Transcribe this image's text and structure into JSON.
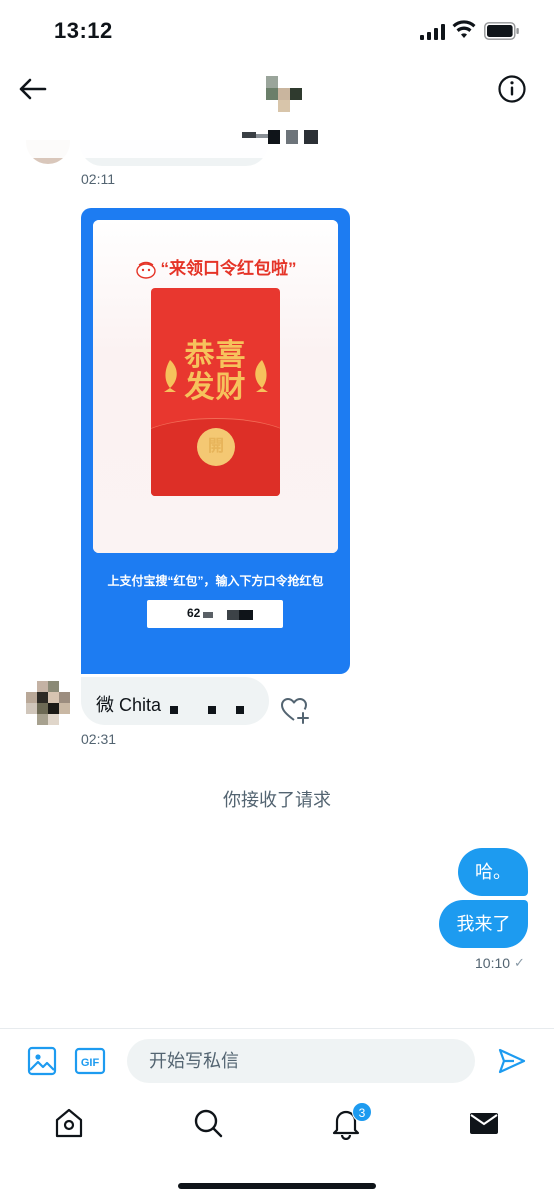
{
  "status_bar": {
    "time": "13:12"
  },
  "header": {
    "back_icon": "arrow-left-icon",
    "info_icon": "info-icon"
  },
  "conversation": {
    "first_timestamp": "02:11",
    "shared_card": {
      "title": "“来领口令红包啦”",
      "envelope_line1": "恭喜",
      "envelope_line2": "发财",
      "open_label": "開",
      "caption": "上支付宝搜“红包”，输入下方口令抢红包",
      "code_prefix": "62"
    },
    "received_message": {
      "text": "微 Chita",
      "timestamp": "02:31"
    },
    "system_message": "你接收了请求",
    "sent_messages": [
      "哈。",
      "我来了"
    ],
    "sent_timestamp": "10:10",
    "read_indicator": "✓"
  },
  "composer": {
    "placeholder": "开始写私信",
    "gif_label": "GIF"
  },
  "nav": {
    "notification_count": "3"
  },
  "colors": {
    "accent": "#1d9bf0",
    "card_blue": "#1d7cf2",
    "envelope_red": "#e8372f"
  }
}
